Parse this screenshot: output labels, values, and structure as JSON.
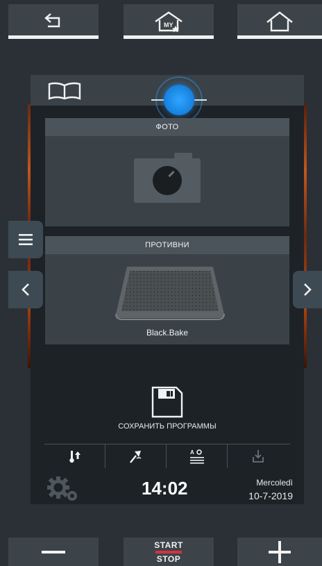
{
  "topbar": {
    "back_icon": "back-arrow-icon",
    "myhome_icon": "my-home-icon",
    "myhome_badge": "MY",
    "home_icon": "home-icon"
  },
  "panel": {
    "book_icon": "book-icon",
    "foto": {
      "label": "ФОТО",
      "icon": "camera-icon"
    },
    "trays": {
      "label": "ПРОТИВНИ",
      "item": "Black.Bake",
      "icon": "baking-tray-image"
    },
    "save": {
      "label": "СОХРАНИТЬ ПРОГРАММЫ",
      "icon": "floppy-disk-icon"
    },
    "tool_icons": [
      "temperature-up-icon",
      "probe-icon",
      "text-settings-icon",
      "download-icon"
    ],
    "status": {
      "time": "14:02",
      "day": "Mercoledì",
      "date": "10-7-2019",
      "icon": "settings-gears-icon"
    }
  },
  "side_buttons": {
    "menu_icon": "hamburger-menu-icon",
    "prev_icon": "chevron-left-icon",
    "next_icon": "chevron-right-icon"
  },
  "bottom": {
    "minus_icon": "minus-icon",
    "start": "START",
    "stop": "STOP",
    "plus_icon": "plus-icon"
  },
  "colors": {
    "accent": "#1e8cf0",
    "stop_line": "#d8323c",
    "orange_glow": "#c4561c"
  }
}
